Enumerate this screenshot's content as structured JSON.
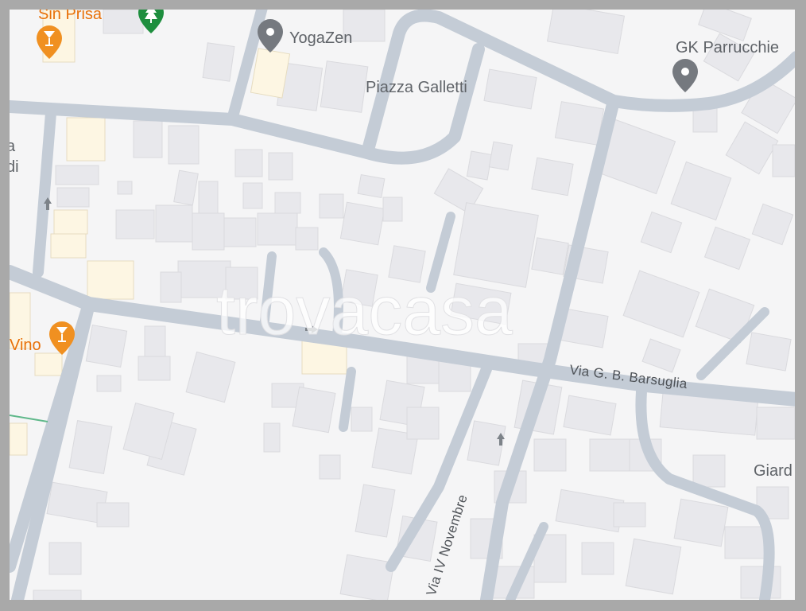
{
  "map": {
    "watermark": "trovacasa",
    "streets": {
      "barsuglia": "Via G. B. Barsuglia",
      "novembre": "Via IV Novembre"
    },
    "places": {
      "yogazen": "YogaZen",
      "piazza_galletti": "Piazza Galletti",
      "gk_parrucchieri": "GK Parrucchie",
      "sin_prisa": "Sin Prisa",
      "vino": "Vino",
      "giardino": "Giard",
      "left_fragment_a": "a",
      "left_fragment_b": "di"
    },
    "icons": {
      "bar": "cocktail-glass-icon",
      "park": "tree-icon",
      "place": "location-pin-icon",
      "direction": "one-way-arrow-icon"
    },
    "colors": {
      "road": "#c4ccd6",
      "building": "#e8e8ec",
      "building_stroke": "#dadade",
      "highlight_building": "#fdf6e3",
      "bar_pin": "#f09021",
      "park_pin": "#1e8e3e",
      "place_pin": "#75797f",
      "background": "#f5f5f6"
    }
  }
}
